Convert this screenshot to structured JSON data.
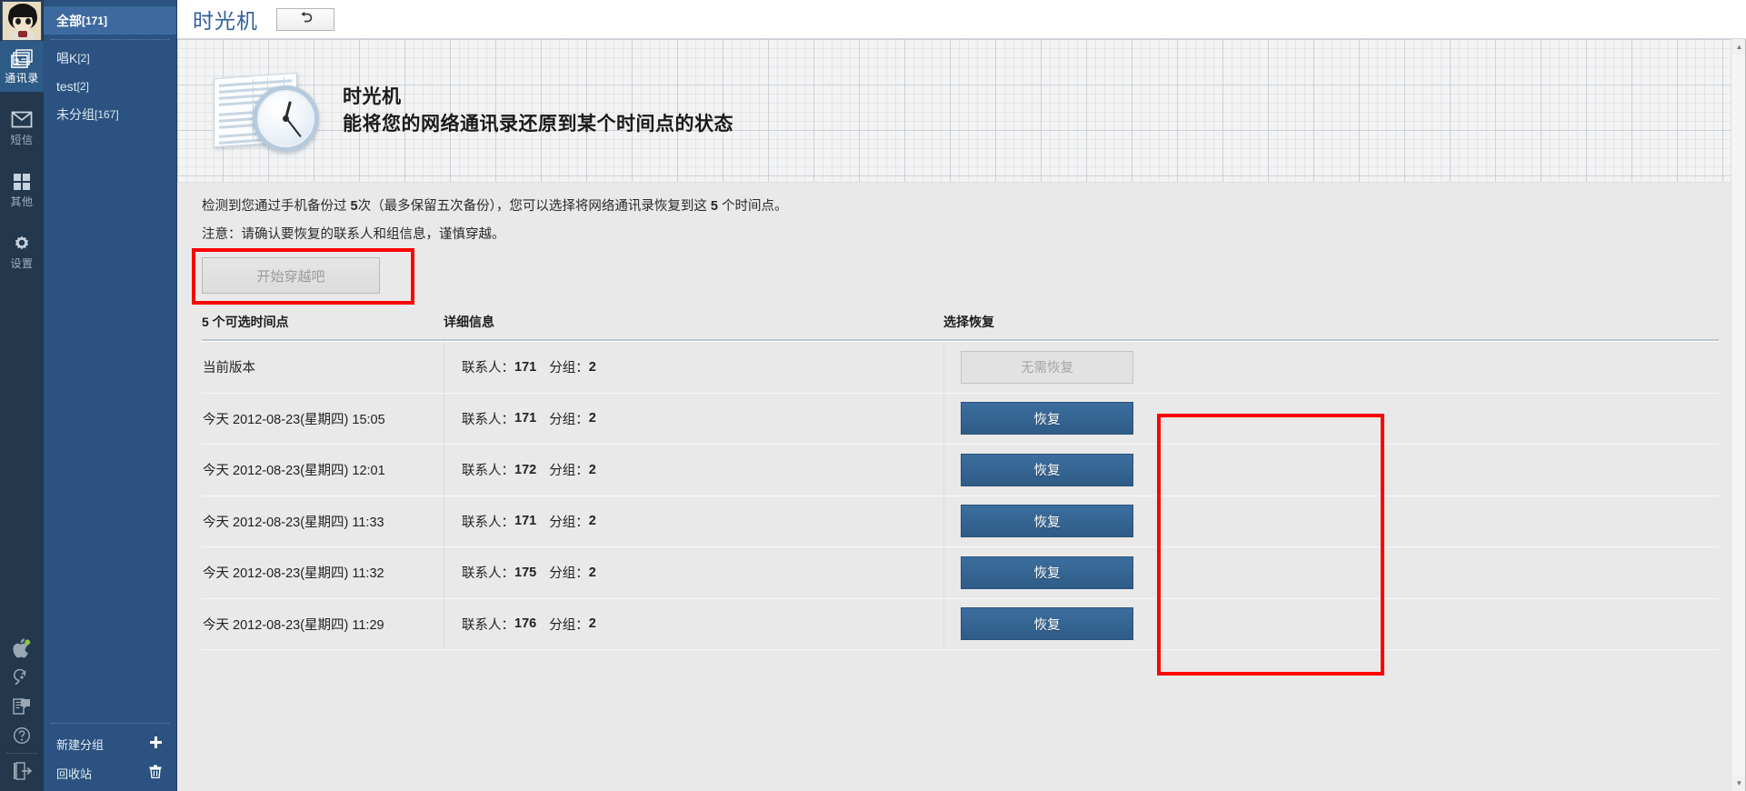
{
  "rail": {
    "avatar_name": "user-avatar",
    "items": [
      {
        "label": "通讯录",
        "icon": "contacts-icon",
        "active": true
      },
      {
        "label": "短信",
        "icon": "message-icon",
        "active": false
      },
      {
        "label": "其他",
        "icon": "grid-icon",
        "active": false
      },
      {
        "label": "设置",
        "icon": "gear-icon",
        "active": false
      }
    ],
    "bottom_icons": [
      "apple-icon",
      "magnifier-icon",
      "feedback-icon",
      "help-icon",
      "logout-icon"
    ]
  },
  "groups": {
    "items": [
      {
        "name": "全部",
        "count": "[171]",
        "selected": true
      },
      {
        "name": "唱K",
        "count": "[2]",
        "selected": false
      },
      {
        "name": "test",
        "count": "[2]",
        "selected": false
      },
      {
        "name": "未分组",
        "count": "[167]",
        "selected": false
      }
    ],
    "new_group": "新建分组",
    "new_group_icon": "plus-icon",
    "recycle_bin": "回收站",
    "recycle_bin_icon": "trash-icon"
  },
  "topbar": {
    "title": "时光机",
    "back_icon": "undo-arrow-icon"
  },
  "banner": {
    "heading": "时光机",
    "subheading": "能将您的网络通讯录还原到某个时间点的状态"
  },
  "notice": {
    "line1_a": "检测到您通过手机备份过 ",
    "line1_count": "5",
    "line1_b": "次（最多保留五次备份），您可以选择将网络通讯录恢复到这 ",
    "line1_count2": "5",
    "line1_c": " 个时间点。",
    "line2": "注意：请确认要恢复的联系人和组信息，谨慎穿越。",
    "start_button": "开始穿越吧"
  },
  "table": {
    "headers": {
      "time": "5 个可选时间点",
      "detail": "详细信息",
      "action": "选择恢复"
    },
    "rows": [
      {
        "time": "当前版本",
        "contacts_label": "联系人：",
        "contacts": "171",
        "groups_label": "分组：",
        "groups": "2",
        "action": "无需恢复",
        "enabled": false
      },
      {
        "time": "今天 2012-08-23(星期四) 15:05",
        "contacts_label": "联系人：",
        "contacts": "171",
        "groups_label": "分组：",
        "groups": "2",
        "action": "恢复",
        "enabled": true
      },
      {
        "time": "今天 2012-08-23(星期四) 12:01",
        "contacts_label": "联系人：",
        "contacts": "172",
        "groups_label": "分组：",
        "groups": "2",
        "action": "恢复",
        "enabled": true
      },
      {
        "time": "今天 2012-08-23(星期四) 11:33",
        "contacts_label": "联系人：",
        "contacts": "171",
        "groups_label": "分组：",
        "groups": "2",
        "action": "恢复",
        "enabled": true
      },
      {
        "time": "今天 2012-08-23(星期四) 11:32",
        "contacts_label": "联系人：",
        "contacts": "175",
        "groups_label": "分组：",
        "groups": "2",
        "action": "恢复",
        "enabled": true
      },
      {
        "time": "今天 2012-08-23(星期四) 11:29",
        "contacts_label": "联系人：",
        "contacts": "176",
        "groups_label": "分组：",
        "groups": "2",
        "action": "恢复",
        "enabled": true
      }
    ]
  },
  "colors": {
    "rail_bg": "#23374d",
    "group_bg": "#2b5280",
    "group_selected": "#3d6a9e",
    "accent_blue": "#2f6099",
    "button_blue": "#35659a",
    "highlight_red": "#ff0000",
    "content_bg": "#e9e9e9"
  },
  "scrollbar": {
    "up_arrow": "▲",
    "down_arrow": "▼"
  }
}
